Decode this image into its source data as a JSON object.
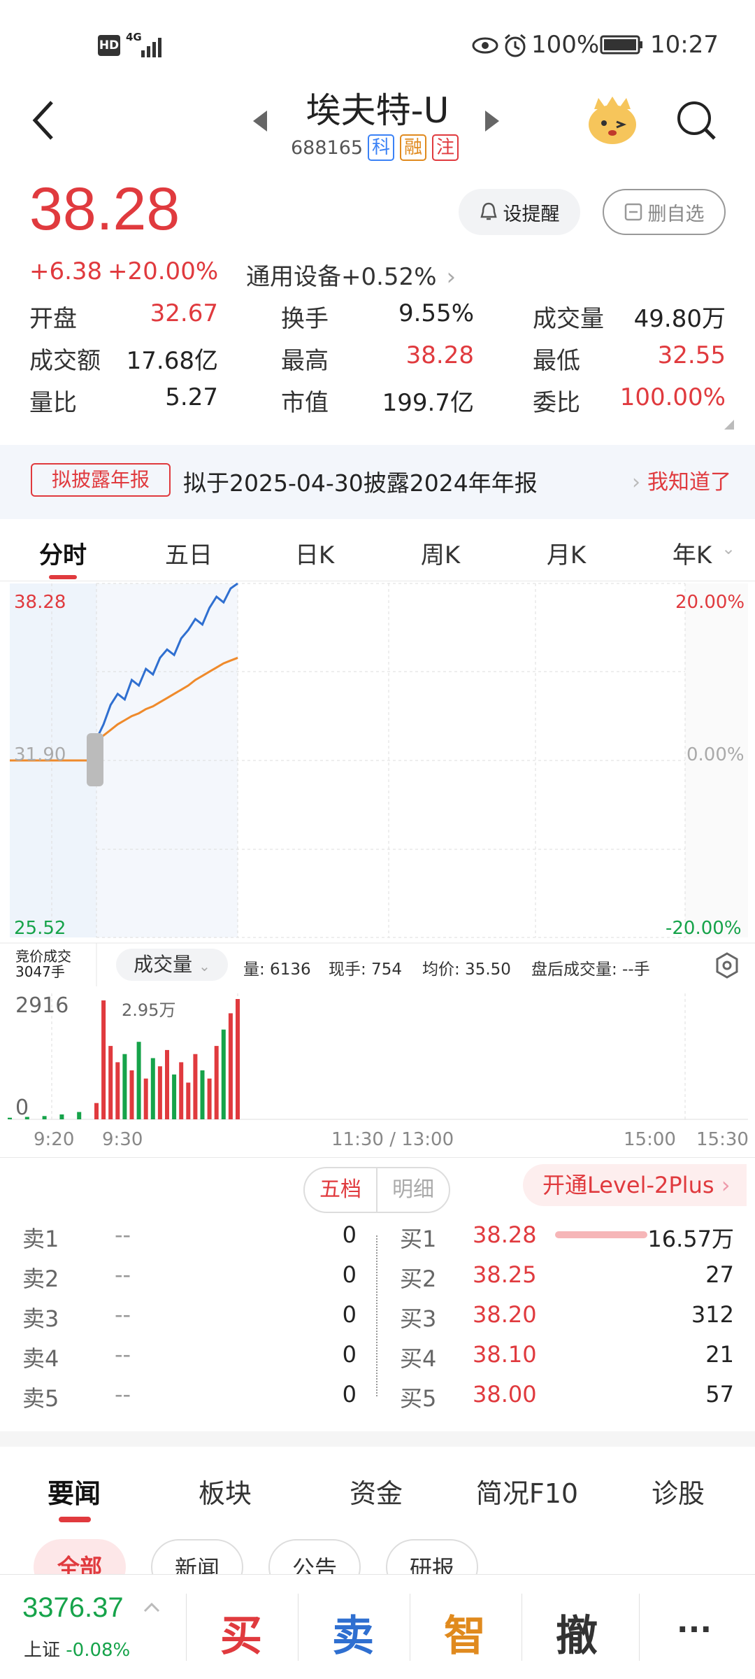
{
  "status_bar": {
    "hd": "HD",
    "net": "4G",
    "battery_pct": "100%",
    "time": "10:27"
  },
  "header": {
    "title": "埃夫特-U",
    "code": "688165",
    "tags": [
      "科",
      "融",
      "注"
    ]
  },
  "quote": {
    "price": "38.28",
    "change": "+6.38",
    "change_pct": "+20.00%",
    "sector": "通用设备",
    "sector_pct": "+0.52%",
    "remind_label": "设提醒",
    "delete_label": "删自选"
  },
  "stats": [
    {
      "label": "开盘",
      "value": "32.67",
      "color": "red"
    },
    {
      "label": "换手",
      "value": "9.55%",
      "color": "dark"
    },
    {
      "label": "成交量",
      "value": "49.80万",
      "color": "dark"
    },
    {
      "label": "成交额",
      "value": "17.68亿",
      "color": "dark"
    },
    {
      "label": "最高",
      "value": "38.28",
      "color": "red"
    },
    {
      "label": "最低",
      "value": "32.55",
      "color": "red"
    },
    {
      "label": "量比",
      "value": "5.27",
      "color": "dark"
    },
    {
      "label": "市值",
      "value": "199.7亿",
      "color": "dark"
    },
    {
      "label": "委比",
      "value": "100.00%",
      "color": "red"
    }
  ],
  "banner": {
    "tag": "拟披露年报",
    "text": "拟于2025-04-30披露2024年年报",
    "action": "我知道了"
  },
  "chart_tabs": [
    "分时",
    "五日",
    "日K",
    "周K",
    "月K",
    "年K"
  ],
  "chart": {
    "top_price": "38.28",
    "mid_price": "31.90",
    "bottom_price": "25.52",
    "top_pct": "20.00%",
    "mid_pct": "0.00%",
    "bottom_pct": "-20.00%",
    "auction_label_1": "竞价成交",
    "auction_label_2": "3047手",
    "volume_selector": "成交量",
    "vol_stat": "量: 6136",
    "now_hand": "现手: 754",
    "avg_price": "均价: 35.50",
    "after_hours": "盘后成交量: --手",
    "vol_max": "2916",
    "vol_peak": "2.95万",
    "vol_zero": "0",
    "times": [
      "9:20",
      "9:30",
      "11:30 / 13:00",
      "15:00",
      "15:30"
    ]
  },
  "chart_data": {
    "type": "line",
    "series": [
      {
        "values": [
          31.9,
          31.9,
          31.9,
          31.9,
          31.9,
          31.9,
          32.67,
          33.2,
          33.9,
          34.3,
          34.1,
          34.8,
          34.6,
          35.2,
          35.0,
          35.6,
          35.9,
          35.7,
          36.3,
          36.6,
          37.0,
          36.8,
          37.4,
          37.8,
          37.6,
          38.1,
          38.28
        ]
      },
      {
        "values": [
          31.9,
          31.9,
          31.9,
          31.9,
          31.9,
          31.9,
          32.6,
          32.8,
          33.0,
          33.2,
          33.35,
          33.5,
          33.6,
          33.75,
          33.85,
          34.0,
          34.15,
          34.3,
          34.45,
          34.6,
          34.8,
          34.95,
          35.1,
          35.25,
          35.4,
          35.5,
          35.6
        ]
      }
    ],
    "ylim": [
      25.52,
      38.28
    ],
    "volume": [
      40,
      60,
      80,
      120,
      180,
      260,
      400,
      2916,
      1800,
      1400,
      1600,
      1200,
      1900,
      1000,
      1500,
      1300,
      1700,
      1100,
      1400,
      900,
      1600,
      1200,
      1000,
      1800,
      2200,
      2600,
      2950
    ]
  },
  "orderbook": {
    "tab_active": "五档",
    "tab_other": "明细",
    "upgrade": "开通Level-2Plus",
    "sells": [
      {
        "label": "卖1",
        "price": "--",
        "vol": "0"
      },
      {
        "label": "卖2",
        "price": "--",
        "vol": "0"
      },
      {
        "label": "卖3",
        "price": "--",
        "vol": "0"
      },
      {
        "label": "卖4",
        "price": "--",
        "vol": "0"
      },
      {
        "label": "卖5",
        "price": "--",
        "vol": "0"
      }
    ],
    "buys": [
      {
        "label": "买1",
        "price": "38.28",
        "vol": "16.57万"
      },
      {
        "label": "买2",
        "price": "38.25",
        "vol": "27"
      },
      {
        "label": "买3",
        "price": "38.20",
        "vol": "312"
      },
      {
        "label": "买4",
        "price": "38.10",
        "vol": "21"
      },
      {
        "label": "买5",
        "price": "38.00",
        "vol": "57"
      }
    ]
  },
  "news_tabs": [
    "要闻",
    "板块",
    "资金",
    "简况F10",
    "诊股"
  ],
  "news_filters": [
    "全部",
    "新闻",
    "公告",
    "研报"
  ],
  "footer": {
    "index_value": "3376.37",
    "index_name": "上证",
    "index_pct": "-0.08%",
    "buttons": [
      "买",
      "卖",
      "智",
      "撤",
      "···"
    ]
  }
}
